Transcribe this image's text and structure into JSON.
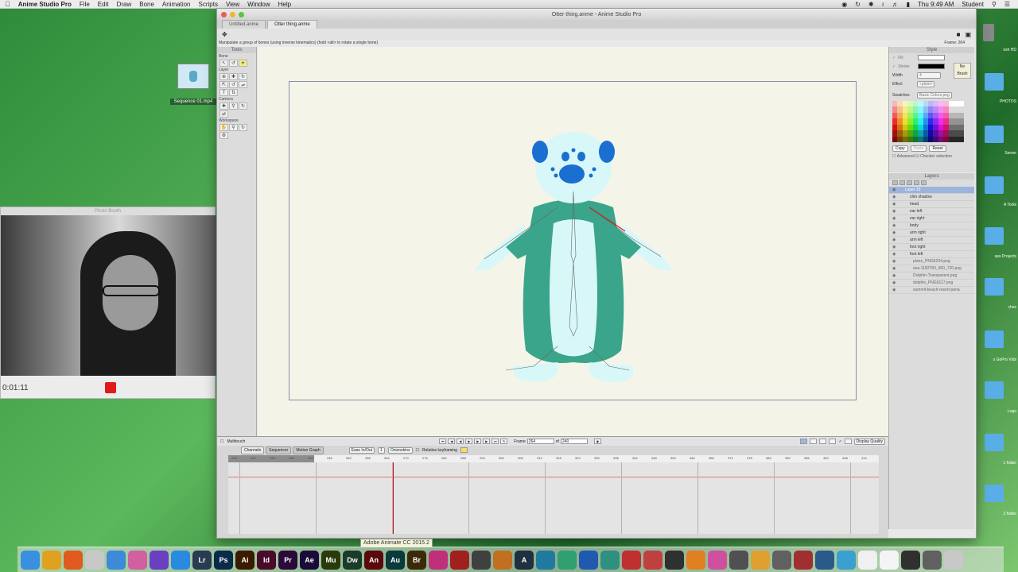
{
  "menubar": {
    "app_name": "Anime Studio Pro",
    "menus": [
      "File",
      "Edit",
      "Draw",
      "Bone",
      "Animation",
      "Scripts",
      "View",
      "Window",
      "Help"
    ],
    "clock": "Thu 9:49 AM",
    "user": "Student"
  },
  "desktop": {
    "file_label": "Sequence 01.mp4",
    "right_labels": [
      "osh HD",
      "PHOTOS",
      "Server",
      "A Tools",
      "ass Projects",
      "ches",
      "s GoPro Vids",
      "Logo",
      "1 folder",
      "2 folder"
    ]
  },
  "photobooth": {
    "title": "Photo Booth",
    "elapsed": "0:01:11"
  },
  "window": {
    "title": "Otter thing.anme - Anime Studio Pro",
    "tabs": [
      "Untitled.anme",
      "Otter thing.anme"
    ],
    "status_tip": "Manipulate a group of bones (using inverse kinematics) (hold <alt> to rotate a single bone)",
    "frame_readout": "Frame: 264"
  },
  "tools": {
    "title": "Tools",
    "sections": [
      "Bone",
      "Layer",
      "Camera",
      "Workspace"
    ]
  },
  "style": {
    "title": "Style",
    "fill_label": "Fill",
    "stroke_label": "Stroke",
    "width_label": "Width",
    "width_value": "4",
    "effect_label": "Effect",
    "effect_value": "<plain>",
    "no_brush": "No Brush",
    "swatches_label": "Swatches",
    "swatches_value": "Basic Colors.png",
    "buttons": [
      "Copy",
      "Paste",
      "Reset"
    ],
    "advanced": "Advanced",
    "checker": "Checker selection",
    "colors": {
      "fill": "#ffffff",
      "stroke": "#000000"
    }
  },
  "layers": {
    "title": "Layers",
    "items": [
      {
        "name": "Layer 10",
        "kind": "group"
      },
      {
        "name": "chin shadow",
        "kind": "vector"
      },
      {
        "name": "head",
        "kind": "vector"
      },
      {
        "name": "ear left",
        "kind": "vector"
      },
      {
        "name": "ear right",
        "kind": "vector"
      },
      {
        "name": "body",
        "kind": "vector"
      },
      {
        "name": "arm right",
        "kind": "vector"
      },
      {
        "name": "arm left",
        "kind": "vector"
      },
      {
        "name": "foot right",
        "kind": "vector"
      },
      {
        "name": "foot left",
        "kind": "vector"
      },
      {
        "name": "plane_PNG5234.png",
        "kind": "image"
      },
      {
        "name": "sea-1182783_960_720.png",
        "kind": "image"
      },
      {
        "name": "Dolphin-Transparent.png",
        "kind": "image"
      },
      {
        "name": "dolphin_PNG9117.png",
        "kind": "image"
      },
      {
        "name": "summit-beach-resort-pana",
        "kind": "image"
      }
    ]
  },
  "timeline": {
    "multitouch": "Multitouch",
    "frame_label": "Frame",
    "frame_value": "264",
    "of_label": "of",
    "total_frames": "240",
    "display_quality": "Display Quality",
    "tabs": [
      "Channels",
      "Sequencer",
      "Motion Graph"
    ],
    "interp": "Ease In/Out",
    "interp_count": "1",
    "onionskins": "Onionskins",
    "relative_keyframing": "Relative keyframing",
    "ruler": [
      "216",
      "222",
      "228",
      "234",
      "240",
      "246",
      "252",
      "258",
      "264",
      "270",
      "276",
      "282",
      "288",
      "294",
      "300",
      "306",
      "312",
      "318",
      "324",
      "330",
      "336",
      "342",
      "348",
      "354",
      "360",
      "366",
      "372",
      "378",
      "384",
      "390",
      "396",
      "402",
      "408",
      "414"
    ],
    "markers": [
      "6",
      "12",
      "18",
      "24",
      "30",
      "36",
      "42",
      "48",
      "54",
      "60",
      "66",
      "72",
      "78",
      "84",
      "90",
      "96",
      "102",
      "108",
      "114"
    ],
    "tooltip": "Adobe Animate CC 2015.2"
  },
  "dock": {
    "apps": [
      {
        "name": "finder",
        "label": "",
        "color": "#3b8fe0"
      },
      {
        "name": "chrome",
        "label": "",
        "color": "#e0a020"
      },
      {
        "name": "firefox",
        "label": "",
        "color": "#e05a20"
      },
      {
        "name": "textedit",
        "label": "",
        "color": "#c8c8c8"
      },
      {
        "name": "keynote",
        "label": "",
        "color": "#3c8ad8"
      },
      {
        "name": "photos",
        "label": "",
        "color": "#d060a0"
      },
      {
        "name": "imovie",
        "label": "",
        "color": "#6a3fc0"
      },
      {
        "name": "safari",
        "label": "",
        "color": "#2a8ae0"
      },
      {
        "name": "lightroom",
        "label": "Lr",
        "color": "#2a3a50"
      },
      {
        "name": "photoshop",
        "label": "Ps",
        "color": "#0a2a4a"
      },
      {
        "name": "illustrator",
        "label": "Ai",
        "color": "#3a1a00"
      },
      {
        "name": "indesign",
        "label": "Id",
        "color": "#4a0a2a"
      },
      {
        "name": "premiere",
        "label": "Pr",
        "color": "#2a0a3a"
      },
      {
        "name": "after-effects",
        "label": "Ae",
        "color": "#1a0a3a"
      },
      {
        "name": "muse",
        "label": "Mu",
        "color": "#2a3a0a"
      },
      {
        "name": "dreamweaver",
        "label": "Dw",
        "color": "#1a3a2a"
      },
      {
        "name": "animate",
        "label": "An",
        "color": "#5a0a0a"
      },
      {
        "name": "audition",
        "label": "Au",
        "color": "#0a3a3a"
      },
      {
        "name": "bridge",
        "label": "Br",
        "color": "#3a2a0a"
      },
      {
        "name": "davinci",
        "label": "",
        "color": "#c0307a"
      },
      {
        "name": "disc",
        "label": "",
        "color": "#a02020"
      },
      {
        "name": "unity-like",
        "label": "",
        "color": "#404040"
      },
      {
        "name": "pen",
        "label": "",
        "color": "#c07020"
      },
      {
        "name": "app-a",
        "label": "A",
        "color": "#203040"
      },
      {
        "name": "app-b",
        "label": "",
        "color": "#207aa0"
      },
      {
        "name": "app-c",
        "label": "",
        "color": "#30a070"
      },
      {
        "name": "app-d",
        "label": "",
        "color": "#205ab0"
      },
      {
        "name": "app-e",
        "label": "",
        "color": "#309080"
      },
      {
        "name": "app-f",
        "label": "",
        "color": "#c03030"
      },
      {
        "name": "app-g",
        "label": "",
        "color": "#c04040"
      },
      {
        "name": "unity",
        "label": "",
        "color": "#303030"
      },
      {
        "name": "app-h",
        "label": "",
        "color": "#e08020"
      },
      {
        "name": "itunes",
        "label": "",
        "color": "#d050a0"
      },
      {
        "name": "app-i",
        "label": "",
        "color": "#505050"
      },
      {
        "name": "app-j",
        "label": "",
        "color": "#e0a030"
      },
      {
        "name": "app-k",
        "label": "",
        "color": "#606060"
      },
      {
        "name": "app-l",
        "label": "",
        "color": "#a03030"
      },
      {
        "name": "app-m",
        "label": "",
        "color": "#2a5a8a"
      },
      {
        "name": "app-n",
        "label": "",
        "color": "#3aa0d0"
      },
      {
        "name": "app-o",
        "label": "",
        "color": "#f0f0f0"
      },
      {
        "name": "app-p",
        "label": "",
        "color": "#f4f4f4"
      },
      {
        "name": "app-q",
        "label": "",
        "color": "#303030"
      },
      {
        "name": "app-r",
        "label": "",
        "color": "#606060"
      },
      {
        "name": "trash",
        "label": "",
        "color": "#c8c8c8"
      }
    ]
  }
}
